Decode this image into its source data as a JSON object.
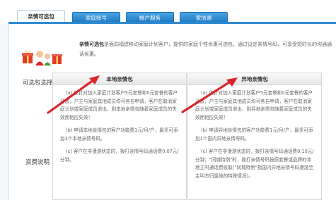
{
  "tabs": [
    {
      "label": "亲情可选包",
      "active": true
    },
    {
      "label": "家庭账号",
      "active": false
    },
    {
      "label": "帐户服务",
      "active": false
    },
    {
      "label": "家信通",
      "active": false
    }
  ],
  "intro": {
    "lead": "亲情可选包",
    "text": "是面向福建移动家庭计划客户，提供的家庭个性优惠可选包，通过设定亲情号码，可享受短时长的沟通通话优惠。"
  },
  "labels": {
    "optional_package": "可选包选择",
    "tariff": "资费说明"
  },
  "cards": {
    "local": {
      "title": "本地亲情包",
      "p1": "(a) 仅针对加入家庭计划客户5元套餐和0元套餐的客户开放，户主与家庭其他成员均可各自申请，客户在取消家庭计划或家庭成员退出，则本地亲情包随着家庭成员的失效而相应失效！",
      "p2": "(b) 申请本地亲情包的客户功能费1元/月/户，最多可添加3个本地亲情号码。",
      "p3": "(c) 客户在非漫游状态时，拨打亲情号码通话费0.07元/分钟。"
    },
    "remote": {
      "title": "异地亲情包",
      "p1": "(a) 仅针对加入家庭计划客户5元套餐和0元套餐的客户开放，户主与家庭其他成员均可各自申请，客户在取消家庭计划或家庭成员退出，则异地亲情包随着家庭成员的失效而相应失效！",
      "p2": "(b) 申请异地亲情包的客户功能费1元/月/户，最多可添加1个国内异地亲情号码。",
      "p3": "(c) 客户在非漫游状态时，拨打亲情号码通话费0.10元/分钟；\"同城特例\"时，拨打亲情号码按原套餐或品牌的本地主叫通话费收取(\"同城特例\"指国内异地亲情号码漫游至主叫方归属地的特殊情况)。"
    }
  },
  "colors": {
    "tab_blue": "#2f8bd0",
    "annotation_red": "#d9262b"
  }
}
